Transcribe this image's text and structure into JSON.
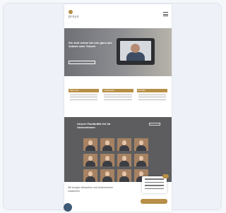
{
  "site": {
    "logo_text": "proyo",
    "hero": {
      "headline": "Sie sind schon bei uns ganz aus Vollzeit oder Teilzeit"
    },
    "cards": [
      {
        "title": "Über uns"
      },
      {
        "title": "Leistungen"
      },
      {
        "title": "Kontakt"
      }
    ],
    "team": {
      "title": "Unsere Fachkräfte für Ihr Unternehmen"
    },
    "footer": {
      "text": "Wir bringen Menschen und Unternehmen zusammen"
    }
  },
  "colors": {
    "accent": "#b78f47",
    "section_gray": "#5d5d5f"
  }
}
